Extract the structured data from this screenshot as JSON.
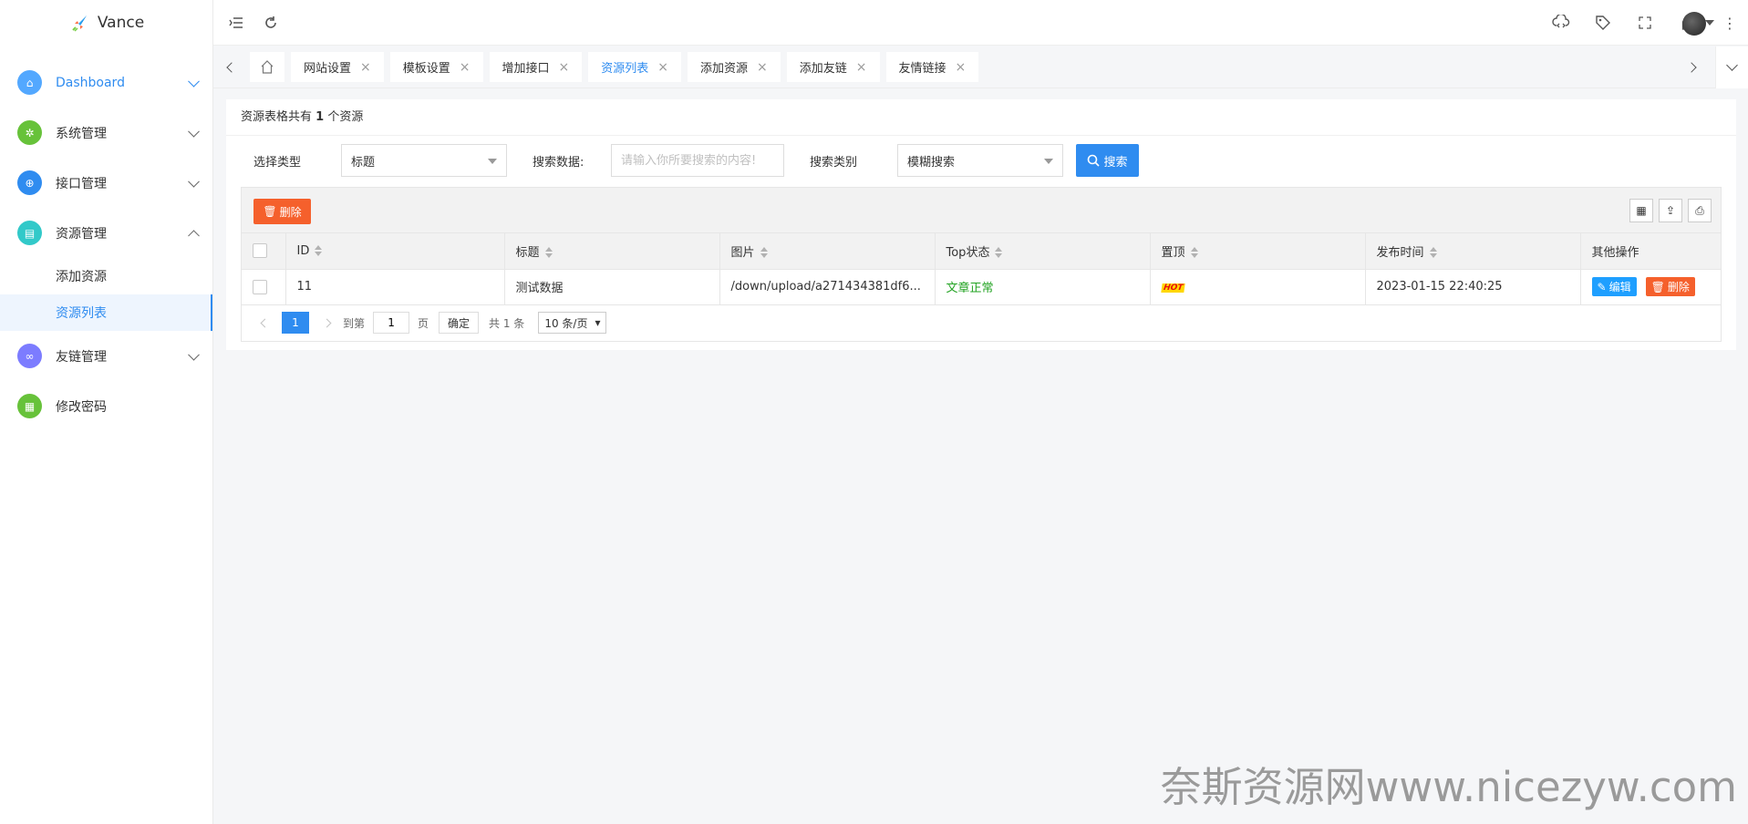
{
  "app": {
    "name": "Vance"
  },
  "sidebar": {
    "items": [
      {
        "label": "Dashboard",
        "icon": "home-icon",
        "color": "#53a8ff",
        "active": true
      },
      {
        "label": "系统管理",
        "icon": "gear-icon",
        "color": "#67c23a"
      },
      {
        "label": "接口管理",
        "icon": "globe-icon",
        "color": "#2f8cf0"
      },
      {
        "label": "资源管理",
        "icon": "folder-icon",
        "color": "#32c9c9"
      },
      {
        "label": "友链管理",
        "icon": "link-icon",
        "color": "#7c7cff"
      },
      {
        "label": "修改密码",
        "icon": "password-icon",
        "color": "#67c23a"
      }
    ],
    "sub_items": [
      {
        "label": "添加资源"
      },
      {
        "label": "资源列表",
        "active": true
      }
    ]
  },
  "tabs": [
    {
      "label": "网站设置"
    },
    {
      "label": "模板设置"
    },
    {
      "label": "增加接口"
    },
    {
      "label": "资源列表",
      "active": true
    },
    {
      "label": "添加资源"
    },
    {
      "label": "添加友链"
    },
    {
      "label": "友情链接"
    }
  ],
  "summary": {
    "prefix": "资源表格共有",
    "count": "1",
    "suffix": "个资源"
  },
  "search": {
    "type_label": "选择类型",
    "type_value": "标题",
    "data_label": "搜索数据:",
    "data_placeholder": "请输入你所要搜索的内容!",
    "category_label": "搜索类别",
    "category_value": "模糊搜索",
    "button_label": "搜索"
  },
  "toolbar": {
    "delete_label": "删除"
  },
  "table": {
    "columns": [
      "ID",
      "标题",
      "图片",
      "Top状态",
      "置顶",
      "发布时间",
      "其他操作"
    ],
    "rows": [
      {
        "id": "11",
        "title": "测试数据",
        "image": "/down/upload/a271434381df6...",
        "status": "文章正常",
        "top": "HOT",
        "time": "2023-01-15 22:40:25",
        "edit_label": "编辑",
        "delete_label": "删除"
      }
    ]
  },
  "pager": {
    "current": "1",
    "goto_label": "到第",
    "goto_value": "1",
    "page_label": "页",
    "confirm_label": "确定",
    "total_label": "共 1 条",
    "size_label": "10 条/页"
  },
  "watermark": "奈斯资源网www.nicezyw.com",
  "colors": {
    "primary": "#2f8cf0",
    "danger": "#f5602c",
    "success": "#22a322"
  }
}
